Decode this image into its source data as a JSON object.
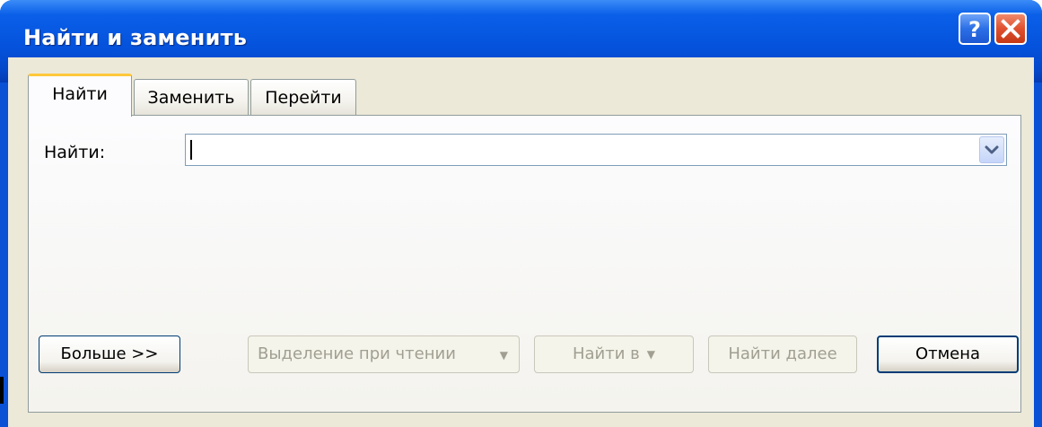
{
  "window": {
    "title": "Найти и заменить",
    "title_bar_color": "#0553dd",
    "help_icon": "question-mark-icon",
    "close_icon": "close-x-icon"
  },
  "tabs": [
    {
      "label": "Найти",
      "active": true
    },
    {
      "label": "Заменить",
      "active": false
    },
    {
      "label": "Перейти",
      "active": false
    }
  ],
  "find": {
    "label": "Найти:",
    "value": "",
    "dropdown_icon": "chevron-down-icon"
  },
  "buttons": {
    "more": "Больше >>",
    "reading_highlight": "Выделение при чтении",
    "find_in": "Найти в",
    "find_next": "Найти далее",
    "cancel": "Отмена"
  },
  "disabled_buttons": [
    "Выделение при чтении",
    "Найти в",
    "Найти далее"
  ]
}
